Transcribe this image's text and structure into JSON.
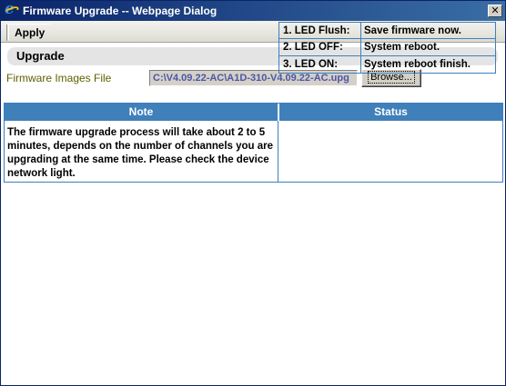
{
  "window": {
    "title": "Firmware Upgrade -- Webpage Dialog",
    "close_glyph": "✕"
  },
  "toolbar": {
    "apply_label": "Apply"
  },
  "upgrade": {
    "heading": "Upgrade",
    "firmware_label": "Firmware Images File",
    "firmware_path": "C:\\V4.09.22-AC\\A1D-310-V4.09.22-AC.upg",
    "browse_label": "Browse..."
  },
  "info": {
    "note_header": "Note",
    "status_header": "Status",
    "note_text": "The firmware upgrade process will take about 2 to 5 minutes, depends on the number of channels you are upgrading at the same time. Please check the device network light.",
    "status_rows": [
      {
        "led": "1. LED Flush:",
        "meaning": "Save firmware now."
      },
      {
        "led": "2. LED OFF:",
        "meaning": "System reboot."
      },
      {
        "led": "3. LED ON:",
        "meaning": "System reboot finish."
      }
    ]
  },
  "colors": {
    "title_bar": "#0a246a",
    "header_blue": "#3f7fba"
  },
  "icons": {
    "app": "ie-icon",
    "close": "close-icon"
  }
}
